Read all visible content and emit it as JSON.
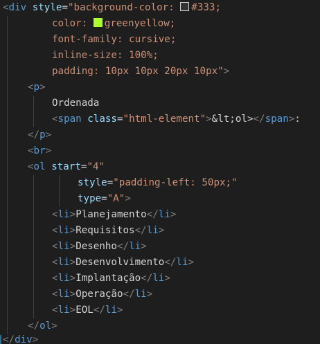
{
  "colors": {
    "background": "#1e1e1e",
    "bracket": "#808080",
    "tag": "#569cd6",
    "attribute": "#9cdcfe",
    "string": "#ce9178",
    "text": "#d4d4d4",
    "entity": "#d4d4d4",
    "indent_guide": "#404040",
    "swatch_dark": "#333333",
    "swatch_green": "#adff2f"
  },
  "code": {
    "lines": [
      [
        [
          "bracket",
          "<"
        ],
        [
          "tag",
          "div"
        ],
        [
          "text",
          " "
        ],
        [
          "attribute",
          "style"
        ],
        [
          "text",
          "="
        ],
        [
          "string",
          "\"background-color: "
        ],
        [
          "swatch",
          "#333333"
        ],
        [
          "string",
          "#333;"
        ]
      ],
      [
        [
          "string",
          "color: "
        ],
        [
          "swatch",
          "#adff2f"
        ],
        [
          "string",
          "greenyellow;"
        ]
      ],
      [
        [
          "string",
          "font-family: cursive;"
        ]
      ],
      [
        [
          "string",
          "inline-size: 100%;"
        ]
      ],
      [
        [
          "string",
          "padding: 10px 10px 20px 10px\""
        ],
        [
          "bracket",
          ">"
        ]
      ],
      [
        [
          "bracket",
          "<"
        ],
        [
          "tag",
          "p"
        ],
        [
          "bracket",
          ">"
        ]
      ],
      [
        [
          "text",
          "Ordenada"
        ]
      ],
      [
        [
          "bracket",
          "<"
        ],
        [
          "tag",
          "span"
        ],
        [
          "text",
          " "
        ],
        [
          "attribute",
          "class"
        ],
        [
          "text",
          "="
        ],
        [
          "string",
          "\"html-element\""
        ],
        [
          "bracket",
          ">"
        ],
        [
          "entity",
          "&lt;"
        ],
        [
          "text",
          "ol"
        ],
        [
          "entity",
          ">"
        ],
        [
          "bracket",
          "</"
        ],
        [
          "tag",
          "span"
        ],
        [
          "bracket",
          ">"
        ],
        [
          "text",
          ":"
        ]
      ],
      [
        [
          "bracket",
          "</"
        ],
        [
          "tag",
          "p"
        ],
        [
          "bracket",
          ">"
        ]
      ],
      [
        [
          "bracket",
          "<"
        ],
        [
          "tag",
          "br"
        ],
        [
          "bracket",
          ">"
        ]
      ],
      [
        [
          "bracket",
          "<"
        ],
        [
          "tag",
          "ol"
        ],
        [
          "text",
          " "
        ],
        [
          "attribute",
          "start"
        ],
        [
          "text",
          "="
        ],
        [
          "string",
          "\"4\""
        ]
      ],
      [
        [
          "attribute",
          "style"
        ],
        [
          "text",
          "="
        ],
        [
          "string",
          "\"padding-left: 50px;\""
        ]
      ],
      [
        [
          "attribute",
          "type"
        ],
        [
          "text",
          "="
        ],
        [
          "string",
          "\"A\""
        ],
        [
          "bracket",
          ">"
        ]
      ],
      [
        [
          "bracket",
          "<"
        ],
        [
          "tag",
          "li"
        ],
        [
          "bracket",
          ">"
        ],
        [
          "text",
          "Planejamento"
        ],
        [
          "bracket",
          "</"
        ],
        [
          "tag",
          "li"
        ],
        [
          "bracket",
          ">"
        ]
      ],
      [
        [
          "bracket",
          "<"
        ],
        [
          "tag",
          "li"
        ],
        [
          "bracket",
          ">"
        ],
        [
          "text",
          "Requisitos"
        ],
        [
          "bracket",
          "</"
        ],
        [
          "tag",
          "li"
        ],
        [
          "bracket",
          ">"
        ]
      ],
      [
        [
          "bracket",
          "<"
        ],
        [
          "tag",
          "li"
        ],
        [
          "bracket",
          ">"
        ],
        [
          "text",
          "Desenho"
        ],
        [
          "bracket",
          "</"
        ],
        [
          "tag",
          "li"
        ],
        [
          "bracket",
          ">"
        ]
      ],
      [
        [
          "bracket",
          "<"
        ],
        [
          "tag",
          "li"
        ],
        [
          "bracket",
          ">"
        ],
        [
          "text",
          "Desenvolvimento"
        ],
        [
          "bracket",
          "</"
        ],
        [
          "tag",
          "li"
        ],
        [
          "bracket",
          ">"
        ]
      ],
      [
        [
          "bracket",
          "<"
        ],
        [
          "tag",
          "li"
        ],
        [
          "bracket",
          ">"
        ],
        [
          "text",
          "Implantação"
        ],
        [
          "bracket",
          "</"
        ],
        [
          "tag",
          "li"
        ],
        [
          "bracket",
          ">"
        ]
      ],
      [
        [
          "bracket",
          "<"
        ],
        [
          "tag",
          "li"
        ],
        [
          "bracket",
          ">"
        ],
        [
          "text",
          "Operação"
        ],
        [
          "bracket",
          "</"
        ],
        [
          "tag",
          "li"
        ],
        [
          "bracket",
          ">"
        ]
      ],
      [
        [
          "bracket",
          "<"
        ],
        [
          "tag",
          "li"
        ],
        [
          "bracket",
          ">"
        ],
        [
          "text",
          "EOL"
        ],
        [
          "bracket",
          "</"
        ],
        [
          "tag",
          "li"
        ],
        [
          "bracket",
          ">"
        ]
      ],
      [
        [
          "bracket",
          "</"
        ],
        [
          "tag",
          "ol"
        ],
        [
          "bracket",
          ">"
        ]
      ],
      [
        [
          "bracket",
          "</"
        ],
        [
          "tag",
          "div"
        ],
        [
          "bracket",
          ">"
        ]
      ]
    ]
  }
}
